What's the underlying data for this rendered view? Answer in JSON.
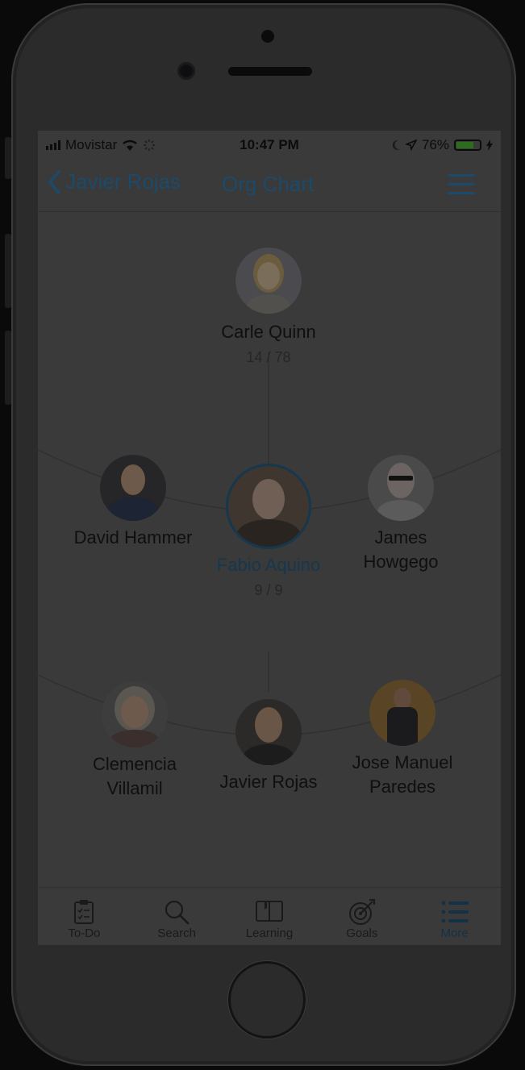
{
  "status_bar": {
    "carrier": "Movistar",
    "time": "10:47 PM",
    "battery_percent": "76%",
    "battery_level": 0.76,
    "icons": [
      "signal-icon",
      "wifi-icon",
      "activity-spinner-icon",
      "moon-icon",
      "location-arrow-icon",
      "battery-icon",
      "charging-bolt-icon"
    ]
  },
  "nav": {
    "back_label": "Javier Rojas",
    "title": "Org Chart",
    "menu_icon": "list-icon"
  },
  "org": {
    "top": {
      "name": "Carle Quinn",
      "count": "14 / 78"
    },
    "middle_left": {
      "name": "David Hammer"
    },
    "middle_center": {
      "name": "Fabio Aquino",
      "count": "9 / 9",
      "selected": true
    },
    "middle_right": {
      "name": "James\nHowgego",
      "line1": "James",
      "line2": "Howgego"
    },
    "bottom_left": {
      "line1": "Clemencia",
      "line2": "Villamil"
    },
    "bottom_center": {
      "name": "Javier Rojas"
    },
    "bottom_right": {
      "line1": "Jose Manuel",
      "line2": "Paredes"
    }
  },
  "tabs": [
    {
      "label": "To-Do",
      "icon": "clipboard-icon"
    },
    {
      "label": "Search",
      "icon": "search-icon"
    },
    {
      "label": "Learning",
      "icon": "book-icon"
    },
    {
      "label": "Goals",
      "icon": "target-icon"
    },
    {
      "label": "More",
      "icon": "list-icon",
      "active": true
    }
  ],
  "colors": {
    "accent": "#1b4a6b",
    "screen_bg": "#3a3a3a",
    "battery_fill": "#2d6b1f"
  }
}
